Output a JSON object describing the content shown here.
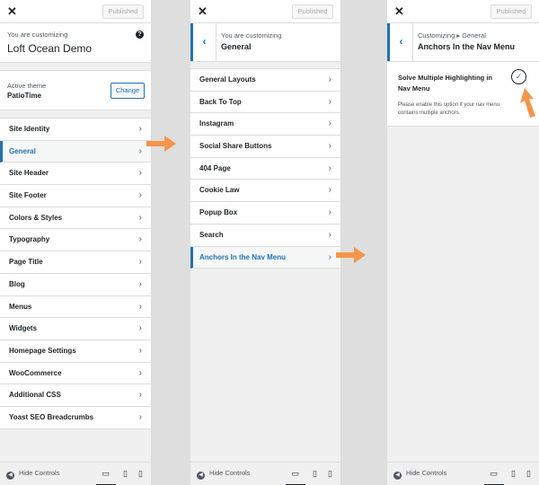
{
  "common": {
    "published_label": "Published",
    "hide_controls_label": "Hide Controls"
  },
  "panel1": {
    "header_subtitle": "You are customizing",
    "header_title": "Loft Ocean Demo",
    "active_theme_label": "Active theme",
    "active_theme_name": "PatioTime",
    "change_label": "Change",
    "items": [
      {
        "label": "Site Identity"
      },
      {
        "label": "General"
      },
      {
        "label": "Site Header"
      },
      {
        "label": "Site Footer"
      },
      {
        "label": "Colors & Styles"
      },
      {
        "label": "Typography"
      },
      {
        "label": "Page Title"
      },
      {
        "label": "Blog"
      },
      {
        "label": "Menus"
      },
      {
        "label": "Widgets"
      },
      {
        "label": "Homepage Settings"
      },
      {
        "label": "WooCommerce"
      },
      {
        "label": "Additional CSS"
      },
      {
        "label": "Yoast SEO Breadcrumbs"
      }
    ]
  },
  "panel2": {
    "header_subtitle": "You are customizing",
    "header_title": "General",
    "items": [
      {
        "label": "General Layouts"
      },
      {
        "label": "Back To Top"
      },
      {
        "label": "Instagram"
      },
      {
        "label": "Social Share Buttons"
      },
      {
        "label": "404 Page"
      },
      {
        "label": "Cookie Law"
      },
      {
        "label": "Popup Box"
      },
      {
        "label": "Search"
      },
      {
        "label": "Anchors In the Nav Menu"
      }
    ]
  },
  "panel3": {
    "header_subtitle": "Customizing ▸ General",
    "header_title": "Anchors In the Nav Menu",
    "option_label": "Solve Multiple Highlighting in Nav Menu",
    "option_description": "Please enable this option if your nav menu contains multiple anchors.",
    "option_checked": true
  },
  "colors": {
    "accent": "#2271b1",
    "arrow": "#f5954a"
  }
}
